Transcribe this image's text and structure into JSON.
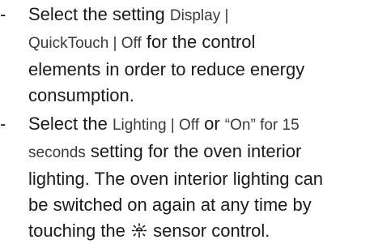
{
  "bullet": "-",
  "item1": {
    "before": "Select the setting ",
    "ui_setting": "Display |\nQuickTouch | Off",
    "after": " for the control\nelements in order to reduce energy\nconsumption."
  },
  "item2": {
    "before": "Select the ",
    "ui_setting": "Lighting | Off",
    "or": " or ",
    "ui_on": "“On” for 15\nseconds",
    "after": " setting for the oven interior\nlighting. The oven interior lighting can\nbe switched on again at any time by\ntouching the ",
    "icon": "light-sun-icon",
    "end": " sensor control."
  }
}
